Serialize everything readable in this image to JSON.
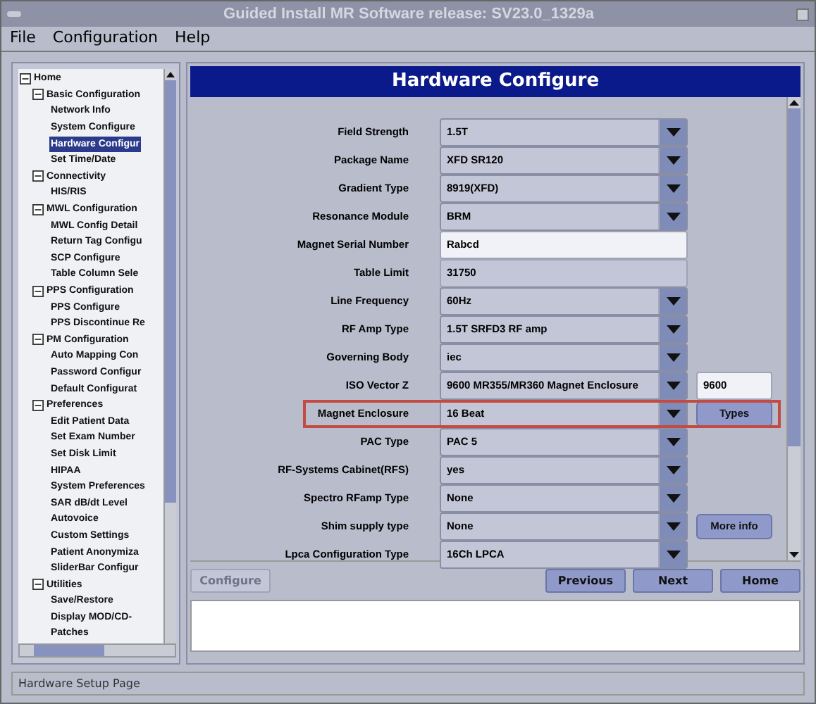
{
  "window": {
    "title": "Guided Install  MR Software release: SV23.0_1329a"
  },
  "menu": [
    "File",
    "Configuration",
    "Help"
  ],
  "tree": [
    {
      "label": "Home",
      "expanded": true,
      "selected": false,
      "children": [
        {
          "label": "Basic Configuration",
          "expanded": true,
          "selected": false,
          "children": [
            {
              "label": "Network Info",
              "selected": false
            },
            {
              "label": "System Configure",
              "selected": false
            },
            {
              "label": "Hardware Configur",
              "selected": true
            },
            {
              "label": "Set Time/Date",
              "selected": false
            }
          ]
        },
        {
          "label": "Connectivity",
          "expanded": true,
          "selected": false,
          "children": [
            {
              "label": "HIS/RIS",
              "selected": false
            }
          ]
        },
        {
          "label": "MWL Configuration",
          "expanded": true,
          "selected": false,
          "children": [
            {
              "label": "MWL Config Detail",
              "selected": false
            },
            {
              "label": "Return Tag Configu",
              "selected": false
            },
            {
              "label": "SCP Configure",
              "selected": false
            },
            {
              "label": "Table Column Sele",
              "selected": false
            }
          ]
        },
        {
          "label": "PPS Configuration",
          "expanded": true,
          "selected": false,
          "children": [
            {
              "label": "PPS Configure",
              "selected": false
            },
            {
              "label": "PPS Discontinue Re",
              "selected": false
            }
          ]
        },
        {
          "label": "PM Configuration",
          "expanded": true,
          "selected": false,
          "children": [
            {
              "label": "Auto Mapping Con",
              "selected": false
            },
            {
              "label": "Password Configur",
              "selected": false
            },
            {
              "label": "Default Configurat",
              "selected": false
            }
          ]
        },
        {
          "label": "Preferences",
          "expanded": true,
          "selected": false,
          "children": [
            {
              "label": "Edit Patient Data",
              "selected": false
            },
            {
              "label": "Set Exam Number",
              "selected": false
            },
            {
              "label": "Set Disk Limit",
              "selected": false
            },
            {
              "label": "HIPAA",
              "selected": false
            },
            {
              "label": "System Preferences",
              "selected": false
            },
            {
              "label": "SAR dB/dt Level",
              "selected": false
            },
            {
              "label": "Autovoice",
              "selected": false
            },
            {
              "label": "Custom Settings",
              "selected": false
            },
            {
              "label": "Patient Anonymiza",
              "selected": false
            },
            {
              "label": "SliderBar Configur",
              "selected": false
            }
          ]
        },
        {
          "label": "Utilities",
          "expanded": true,
          "selected": false,
          "children": [
            {
              "label": "Save/Restore",
              "selected": false
            },
            {
              "label": "Display MOD/CD-",
              "selected": false
            },
            {
              "label": "Patches",
              "selected": false
            }
          ]
        }
      ]
    }
  ],
  "panel": {
    "title": "Hardware Configure",
    "rows": [
      {
        "label": "Field Strength",
        "kind": "dropdown",
        "value": "1.5T",
        "highlighted": false
      },
      {
        "label": "Package Name",
        "kind": "dropdown",
        "value": "XFD SR120",
        "highlighted": false
      },
      {
        "label": "Gradient Type",
        "kind": "dropdown",
        "value": "8919(XFD)",
        "highlighted": false
      },
      {
        "label": "Resonance Module",
        "kind": "dropdown",
        "value": "BRM",
        "highlighted": false
      },
      {
        "label": "Magnet Serial Number",
        "kind": "input",
        "value": "Rabcd",
        "highlighted": false
      },
      {
        "label": "Table Limit",
        "kind": "readonly",
        "value": "31750",
        "highlighted": false
      },
      {
        "label": "Line Frequency",
        "kind": "dropdown",
        "value": "60Hz",
        "highlighted": false
      },
      {
        "label": "RF Amp Type",
        "kind": "dropdown",
        "value": "1.5T SRFD3 RF amp",
        "highlighted": false
      },
      {
        "label": "Governing Body",
        "kind": "dropdown",
        "value": "iec",
        "highlighted": false
      },
      {
        "label": "ISO Vector Z",
        "kind": "dropdown",
        "value": "9600 MR355/MR360 Magnet Enclosure",
        "highlighted": false,
        "extra": {
          "kind": "input",
          "value": "9600"
        }
      },
      {
        "label": "Magnet Enclosure",
        "kind": "dropdown",
        "value": "16 Beat",
        "highlighted": true,
        "extra": {
          "kind": "button",
          "value": "Types"
        }
      },
      {
        "label": "PAC Type",
        "kind": "dropdown",
        "value": "PAC 5",
        "highlighted": false
      },
      {
        "label": "RF-Systems Cabinet(RFS)",
        "kind": "dropdown",
        "value": "yes",
        "highlighted": false
      },
      {
        "label": "Spectro RFamp Type",
        "kind": "dropdown",
        "value": "None",
        "highlighted": false
      },
      {
        "label": "Shim supply type",
        "kind": "dropdown",
        "value": "None",
        "highlighted": false,
        "extra": {
          "kind": "button",
          "value": "More info"
        }
      },
      {
        "label": "Lpca Configuration Type",
        "kind": "dropdown",
        "value": "16Ch LPCA",
        "highlighted": false
      }
    ],
    "buttons": [
      {
        "label": "Configure",
        "disabled": true
      },
      {
        "label": "Previous",
        "disabled": false
      },
      {
        "label": "Next",
        "disabled": false
      },
      {
        "label": "Home",
        "disabled": false
      }
    ]
  },
  "status_bar": "Hardware Setup Page"
}
